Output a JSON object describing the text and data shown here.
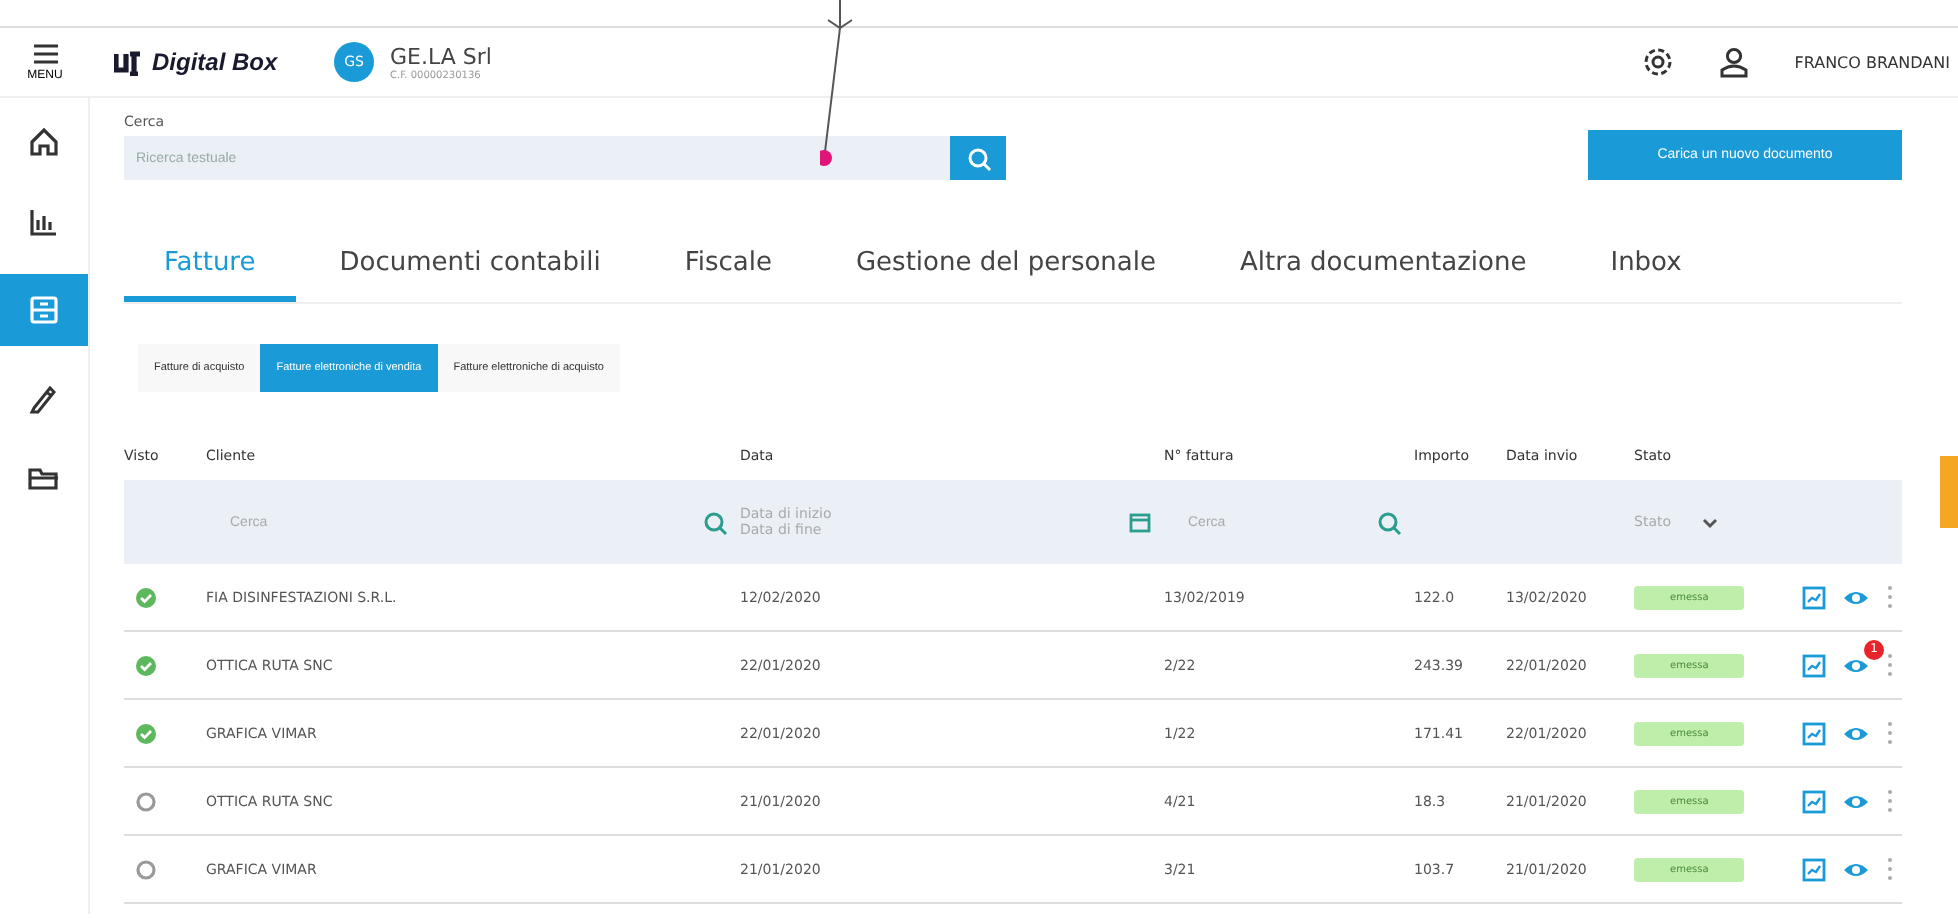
{
  "header": {
    "menu_label": "MENU",
    "logo": "Digital Box",
    "company": {
      "initials": "GS",
      "name": "GE.LA Srl",
      "tax_code": "C.F. 00000230136"
    },
    "user": "FRANCO BRANDANI"
  },
  "sidebar": {
    "items": [
      {
        "kind": "home",
        "selected": false
      },
      {
        "kind": "chart",
        "selected": false
      },
      {
        "kind": "documents",
        "selected": true
      },
      {
        "kind": "pen",
        "selected": false
      },
      {
        "kind": "folder",
        "selected": false
      }
    ]
  },
  "search": {
    "label": "Cerca",
    "placeholder": "Ricerca testuale"
  },
  "upload_button": "Carica un nuovo documento",
  "tabs": [
    {
      "label": "Fatture",
      "selected": true
    },
    {
      "label": "Documenti contabili",
      "selected": false
    },
    {
      "label": "Fiscale",
      "selected": false
    },
    {
      "label": "Gestione del personale",
      "selected": false
    },
    {
      "label": "Altra documentazione",
      "selected": false
    },
    {
      "label": "Inbox",
      "selected": false
    }
  ],
  "subtabs": [
    {
      "label": "Fatture di acquisto",
      "selected": false
    },
    {
      "label": "Fatture elettroniche di vendita",
      "selected": true
    },
    {
      "label": "Fatture elettroniche di acquisto",
      "selected": false
    }
  ],
  "table": {
    "columns": [
      "Visto",
      "Cliente",
      "Data",
      "N° fattura",
      "Importo",
      "Data invio",
      "Stato"
    ],
    "filters": {
      "cliente_placeholder": "Cerca",
      "date_from": "Data di inizio",
      "date_to": "Data di fine",
      "number_placeholder": "Cerca",
      "status_placeholder": "Stato"
    },
    "rows": [
      {
        "seen": true,
        "cliente": "FIA DISINFESTAZIONI S.R.L.",
        "data": "12/02/2020",
        "numero": "13/02/2019",
        "importo": "122.0",
        "data_invio": "13/02/2020",
        "stato": "emessa"
      },
      {
        "seen": true,
        "cliente": "OTTICA RUTA SNC",
        "data": "22/01/2020",
        "numero": "2/22",
        "importo": "243.39",
        "data_invio": "22/01/2020",
        "stato": "emessa",
        "badge": "1"
      },
      {
        "seen": true,
        "cliente": "GRAFICA VIMAR",
        "data": "22/01/2020",
        "numero": "1/22",
        "importo": "171.41",
        "data_invio": "22/01/2020",
        "stato": "emessa"
      },
      {
        "seen": false,
        "cliente": "OTTICA RUTA SNC",
        "data": "21/01/2020",
        "numero": "4/21",
        "importo": "18.3",
        "data_invio": "21/01/2020",
        "stato": "emessa"
      },
      {
        "seen": false,
        "cliente": "GRAFICA VIMAR",
        "data": "21/01/2020",
        "numero": "3/21",
        "importo": "103.7",
        "data_invio": "21/01/2020",
        "stato": "emessa"
      }
    ]
  }
}
